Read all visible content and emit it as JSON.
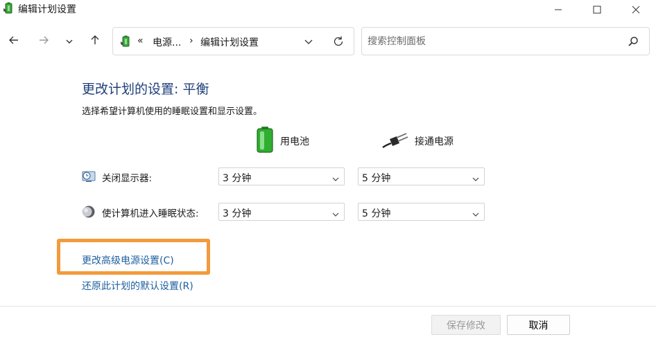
{
  "window": {
    "title": "编辑计划设置",
    "icons": [
      "power-plan-icon",
      "minimize-icon",
      "maximize-icon",
      "close-icon"
    ]
  },
  "nav": {
    "breadcrumb_prefix": "«",
    "breadcrumb_parent": "电源...",
    "breadcrumb_sep": "›",
    "breadcrumb_current": "编辑计划设置",
    "search_placeholder": "搜索控制面板"
  },
  "main": {
    "title": "更改计划的设置: 平衡",
    "subtitle": "选择希望计算机使用的睡眠设置和显示设置。",
    "columns": {
      "battery": "用电池",
      "plugged_in": "接通电源"
    },
    "rows": [
      {
        "label": "关闭显示器:",
        "battery_value": "3 分钟",
        "plugged_value": "5 分钟",
        "icon": "display-clock-icon"
      },
      {
        "label": "使计算机进入睡眠状态:",
        "battery_value": "3 分钟",
        "plugged_value": "5 分钟",
        "icon": "moon-icon"
      }
    ],
    "advanced_link": "更改高级电源设置(C)",
    "restore_link": "还原此计划的默认设置(R)"
  },
  "footer": {
    "save_label": "保存修改",
    "cancel_label": "取消"
  },
  "colors": {
    "title_blue": "#1e3f7a",
    "link_blue": "#1d5fa0",
    "highlight_orange": "#f39a3b"
  }
}
